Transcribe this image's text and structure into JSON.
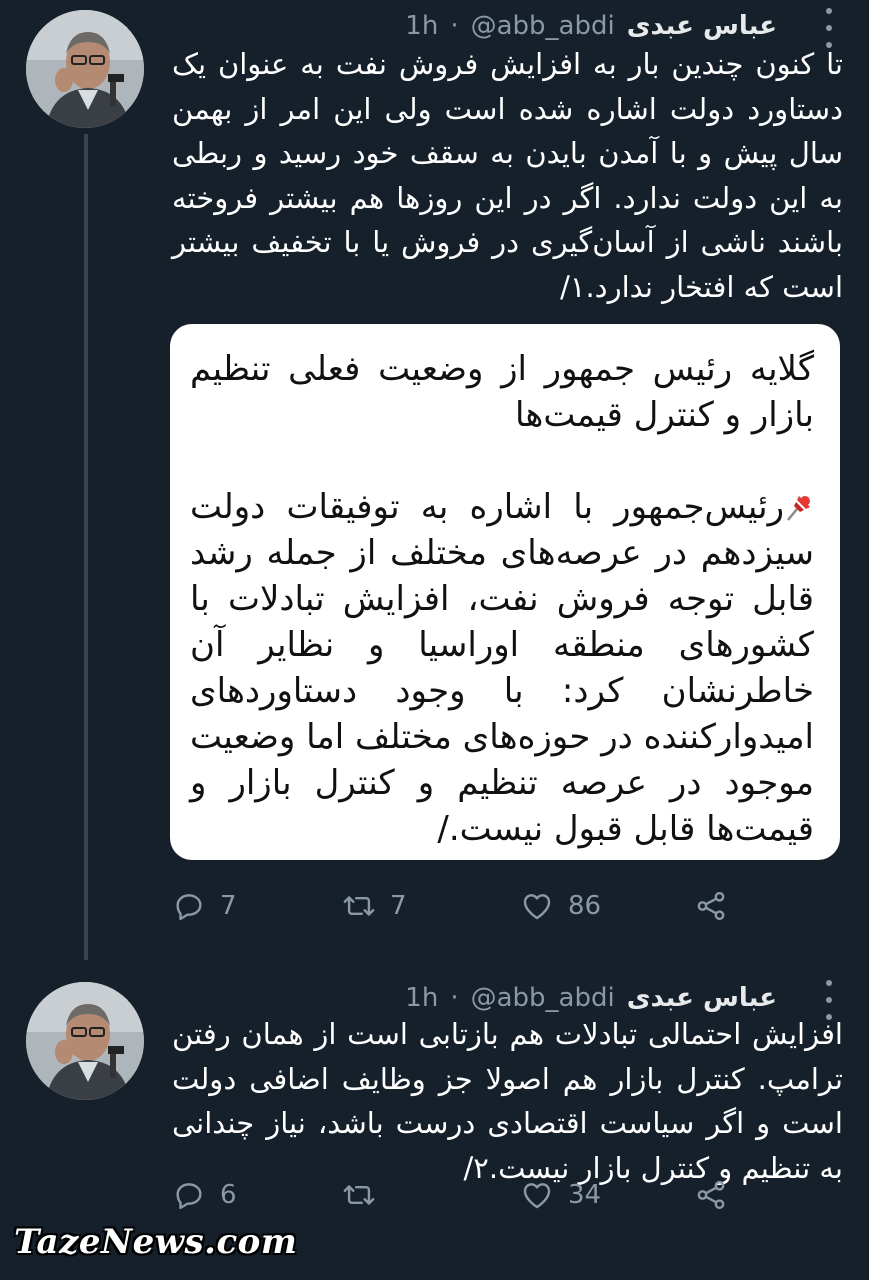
{
  "tweets": [
    {
      "author": {
        "name": "عباس عبدی",
        "handle": "@abb_abdi"
      },
      "separator": "·",
      "time": "1h",
      "text": "تا کنون چندین بار به افزایش فروش نفت به عنوان یک دستاورد دولت اشاره شده است ولی این امر از بهمن سال پیش و با آمدن بایدن به سقف خود رسید و ربطی به این دولت ندارد. اگر در این روزها هم بیشتر فروخته باشند ناشی از آسان‌گیری در فروش یا با تخفیف بیشتر است که افتخار ندارد.۱/",
      "media": {
        "heading": "گلایه رئیس جمهور از وضعیت فعلی تنظیم بازار و کنترل قیمت‌ها",
        "pin_icon": "pushpin-icon",
        "body": "رئیس‌جمهور با اشاره به توفیقات دولت سیزدهم در عرصه‌های مختلف از جمله رشد قابل توجه فروش نفت، افزایش تبادلات با کشورهای منطقه اوراسیا و نظایر آن خاطرنشان کرد: با وجود دستاوردهای امیدوارکننده در حوزه‌های مختلف اما وضعیت موجود در عرصه تنظیم و کنترل بازار و قیمت‌ها قابل قبول نیست./"
      },
      "stats": {
        "replies": "7",
        "retweets": "7",
        "likes": "86"
      }
    },
    {
      "author": {
        "name": "عباس عبدی",
        "handle": "@abb_abdi"
      },
      "separator": "·",
      "time": "1h",
      "text": "افزایش احتمالی تبادلات هم بازتابی است از همان رفتن ترامپ. کنترل بازار هم اصولا جز وظایف اضافی دولت است و اگر سیاست اقتصادی درست باشد، نیاز چندانی به تنظیم و کنترل بازار نیست.۲/",
      "stats": {
        "replies": "6",
        "retweets": "",
        "likes": "34"
      }
    }
  ],
  "watermark": "TazeNews.com",
  "colors": {
    "background": "#15202b",
    "secondary_text": "#8b98a5",
    "thread_line": "#38444d"
  }
}
